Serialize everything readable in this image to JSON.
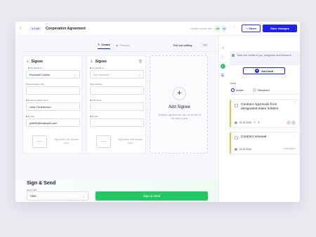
{
  "topbar": {
    "back_icon": "chevron-left-icon",
    "badge": "Draft",
    "title": "Cooperation Agreement",
    "shared_text": "Directly shared with",
    "avatars": [
      "OM",
      "JS"
    ],
    "share_label": "Share",
    "save_label": "Save changes"
  },
  "tabs": [
    {
      "label": "Create",
      "icon": "pencil-icon",
      "active": true
    },
    {
      "label": "Preview",
      "icon": "eye-icon",
      "active": false
    }
  ],
  "full_text_editing": {
    "label": "Full text editing",
    "state": "OFF"
  },
  "signees": [
    {
      "title": "Signee",
      "fields": [
        {
          "label": "On behalf of",
          "required": true,
          "value": "Rockwell Collins",
          "select": true
        },
        {
          "label": "Representative title",
          "required": false,
          "value": "",
          "select": false
        },
        {
          "label": "Representative name",
          "required": true,
          "value": "Julie Christensen",
          "select": false
        },
        {
          "label": "E-mail",
          "required": true,
          "value": "julie85@example.com",
          "select": false
        }
      ],
      "signature_text": "Signature will appear here"
    },
    {
      "title": "Signee",
      "fields": [
        {
          "label": "On behalf of",
          "required": true,
          "value": "Not selected",
          "placeholder": true,
          "select": true
        },
        {
          "label": "Personal title",
          "required": false,
          "value": "",
          "select": false
        },
        {
          "label": "Full name",
          "required": true,
          "value": "",
          "select": false
        },
        {
          "label": "E-mail",
          "required": true,
          "value": "",
          "select": false
        }
      ],
      "signature_text": "Signature will appear here"
    }
  ],
  "add_signee": {
    "title": "Add Signee",
    "subtitle": "Multiple signees can sign on behalf of the same party"
  },
  "sign_send": {
    "title": "Sign & Send",
    "send_via_label": "Send SMS",
    "send_via_value": "SMS",
    "button_label": "Sign & send"
  },
  "sidebar": {
    "info_text": "Tasks are visible to you, assignees and followers",
    "add_task_label": "Add task",
    "tasks_label": "Tasks",
    "filters": [
      {
        "label": "Active",
        "selected": true
      },
      {
        "label": "Resolved",
        "selected": false
      }
    ],
    "tasks": [
      {
        "title": "Contract Approvals from designated stake holders",
        "date": "22.12.2030",
        "count": "3",
        "status": ""
      },
      {
        "title": "Contract renewal",
        "date": "22.12.2030",
        "count": "",
        "status": "Unassigned"
      }
    ]
  },
  "colors": {
    "accent": "#1f1ff0",
    "success": "#22c962",
    "task_flag": "#e9c242"
  }
}
